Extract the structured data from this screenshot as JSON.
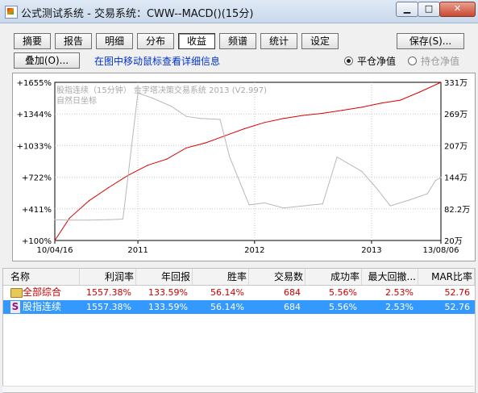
{
  "window": {
    "title": "公式测试系统 - 交易系统：CWW--MACD()(15分)",
    "min": "▁",
    "max": "□",
    "close": "✕"
  },
  "toolbar": {
    "tabs": [
      "摘要",
      "报告",
      "明细",
      "分布",
      "收益",
      "频谱",
      "统计",
      "设定"
    ],
    "active_tab": "收益",
    "save": "保存(S)...",
    "overlay": "叠加(O)...",
    "hint": "在图中移动鼠标查看详细信息"
  },
  "radios": {
    "flat": "平仓净值",
    "hold": "持仓净值",
    "flat_checked": true
  },
  "chart_data": {
    "type": "line",
    "title": "股指连续（15分钟）  金字塔决策交易系统 2013 (V2.997)",
    "subtitle": "自然日坐标",
    "x_range": [
      "2010/04/16",
      "2013/08/06"
    ],
    "x_ticks": [
      "10/04/16",
      "2011",
      "2012",
      "2013",
      "13/08/06"
    ],
    "y_left": {
      "label_unit": "%",
      "ticks": [
        "+100%",
        "+411%",
        "+722%",
        "+1033%",
        "+1344%",
        "+1655%"
      ],
      "range": [
        100,
        1655
      ]
    },
    "y_right": {
      "ticks": [
        "20万",
        "82.2万",
        "144万",
        "207万",
        "269万",
        "331万"
      ],
      "range": [
        20,
        331
      ]
    },
    "series": [
      {
        "name": "平仓净值",
        "color": "#dd0000",
        "x": [
          "2010/04/16",
          "2010/06/01",
          "2010/08/01",
          "2010/10/01",
          "2010/12/01",
          "2011/02/01",
          "2011/04/01",
          "2011/06/01",
          "2011/08/01",
          "2011/10/01",
          "2011/12/01",
          "2012/02/01",
          "2012/04/01",
          "2012/06/01",
          "2012/08/01",
          "2012/10/01",
          "2012/12/01",
          "2013/02/01",
          "2013/04/01",
          "2013/06/01",
          "2013/08/06"
        ],
        "y": [
          100,
          320,
          490,
          620,
          740,
          840,
          900,
          1010,
          1060,
          1130,
          1200,
          1260,
          1300,
          1330,
          1350,
          1380,
          1410,
          1450,
          1480,
          1560,
          1655
        ]
      },
      {
        "name": "股指连续",
        "color": "#b8b8b8",
        "x": [
          "2010/04/16",
          "2010/06/01",
          "2010/08/01",
          "2010/10/01",
          "2010/11/15",
          "2011/01/01",
          "2011/02/15",
          "2011/04/15",
          "2011/06/01",
          "2011/07/15",
          "2011/09/15",
          "2011/10/15",
          "2011/12/15",
          "2012/02/01",
          "2012/04/01",
          "2012/06/01",
          "2012/08/01",
          "2012/09/15",
          "2012/12/01",
          "2013/01/15",
          "2013/03/01",
          "2013/05/01",
          "2013/06/25",
          "2013/07/20",
          "2013/08/06"
        ],
        "y": [
          305,
          300,
          300,
          305,
          310,
          1550,
          1500,
          1420,
          1320,
          1300,
          1290,
          920,
          450,
          470,
          420,
          440,
          460,
          920,
          780,
          620,
          440,
          500,
          560,
          690,
          720
        ]
      }
    ],
    "grid": true
  },
  "table": {
    "columns": [
      "名称",
      "利润率",
      "年回报",
      "胜率",
      "交易数",
      "成功率",
      "最大回撤...",
      "MAR比率"
    ],
    "rows": [
      {
        "name": "全部综合",
        "icon": "folder-icon",
        "values": [
          "1557.38%",
          "133.59%",
          "56.14%",
          "684",
          "5.56%",
          "2.53%",
          "52.76"
        ]
      },
      {
        "name": "股指连续",
        "icon": "s-icon",
        "values": [
          "1557.38%",
          "133.59%",
          "56.14%",
          "684",
          "5.56%",
          "2.53%",
          "52.76"
        ]
      }
    ]
  }
}
